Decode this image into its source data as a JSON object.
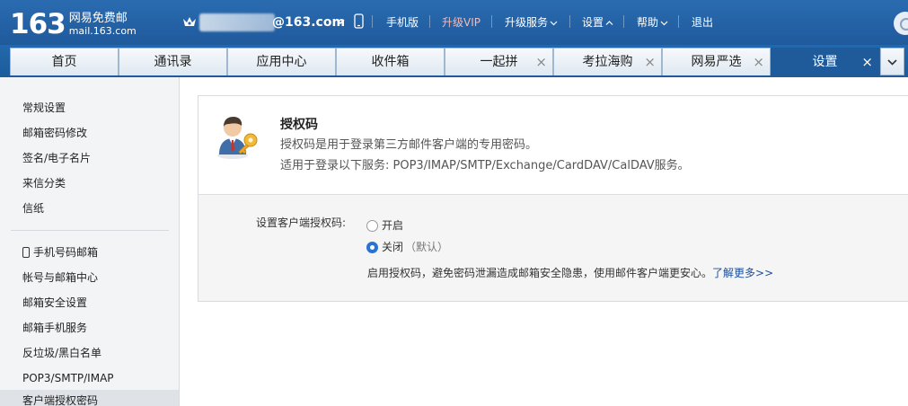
{
  "header": {
    "logo_number": "163",
    "logo_cn": "网易免费邮",
    "logo_url": "mail.163.com",
    "account_suffix": "@163.com",
    "nav": {
      "mobile": "手机版",
      "vip": "升级VIP",
      "upgrade": "升级服务",
      "settings": "设置",
      "help": "帮助",
      "logout": "退出"
    },
    "icons": [
      "crown-icon",
      "phone-icon",
      "search-icon"
    ]
  },
  "tabs": [
    {
      "label": "首页",
      "closable": false
    },
    {
      "label": "通讯录",
      "closable": false
    },
    {
      "label": "应用中心",
      "closable": false
    },
    {
      "label": "收件箱",
      "closable": false
    },
    {
      "label": "一起拼",
      "closable": true
    },
    {
      "label": "考拉海购",
      "closable": true
    },
    {
      "label": "网易严选",
      "closable": true
    },
    {
      "label": "设置",
      "closable": true,
      "active": true
    }
  ],
  "tab_close_glyph": "×",
  "sidebar": {
    "group1": [
      "常规设置",
      "邮箱密码修改",
      "签名/电子名片",
      "来信分类",
      "信纸"
    ],
    "group2": [
      "手机号码邮箱",
      "帐号与邮箱中心",
      "邮箱安全设置",
      "邮箱手机服务",
      "反垃圾/黑白名单",
      "POP3/SMTP/IMAP",
      "客户端授权密码"
    ],
    "active_item": "客户端授权密码"
  },
  "panel": {
    "title": "授权码",
    "desc1": "授权码是用于登录第三方邮件客户端的专用密码。",
    "desc2": "适用于登录以下服务: POP3/IMAP/SMTP/Exchange/CardDAV/CalDAV服务。",
    "setting_label": "设置客户端授权码:",
    "option_on": "开启",
    "option_off": "关闭",
    "option_off_note": "（默认）",
    "selected_option": "关闭",
    "hint": "启用授权码，避免密码泄漏造成邮箱安全隐患，使用邮件客户端更安心。",
    "learn_more": "了解更多>>"
  },
  "colors": {
    "header_blue": "#2a6bb0",
    "active_tab": "#1f5a9b",
    "vip_pink": "#f9b9b0",
    "link_blue": "#1a4e9e",
    "radio_blue": "#2a73d4"
  }
}
